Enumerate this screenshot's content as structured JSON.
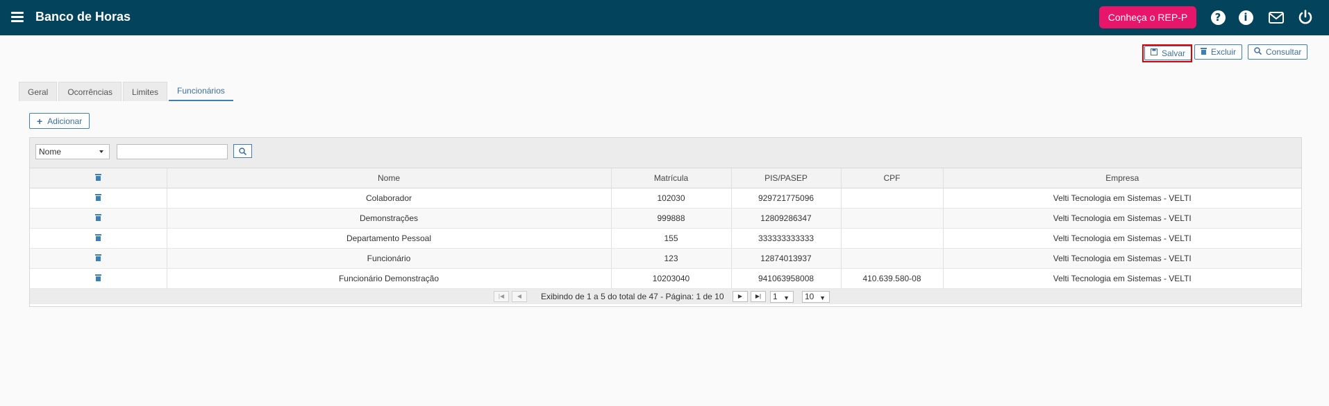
{
  "header": {
    "title": "Banco de Horas",
    "rep_button": "Conheça o REP-P",
    "icons": [
      "help-icon",
      "info-icon",
      "mail-icon",
      "power-icon"
    ]
  },
  "actions": {
    "save": "Salvar",
    "delete": "Excluir",
    "consult": "Consultar"
  },
  "tabs": [
    {
      "label": "Geral"
    },
    {
      "label": "Ocorrências"
    },
    {
      "label": "Limites"
    },
    {
      "label": "Funcionários",
      "active": true
    }
  ],
  "add_button": "Adicionar",
  "filter": {
    "field": "Nome",
    "value": ""
  },
  "table": {
    "columns": [
      "",
      "Nome",
      "Matrícula",
      "PIS/PASEP",
      "CPF",
      "Empresa"
    ],
    "rows": [
      {
        "nome": "Colaborador",
        "matricula": "102030",
        "pis": "929721775096",
        "cpf": "",
        "empresa": "Velti Tecnologia em Sistemas - VELTI"
      },
      {
        "nome": "Demonstrações",
        "matricula": "999888",
        "pis": "12809286347",
        "cpf": "",
        "empresa": "Velti Tecnologia em Sistemas - VELTI"
      },
      {
        "nome": "Departamento Pessoal",
        "matricula": "155",
        "pis": "333333333333",
        "cpf": "",
        "empresa": "Velti Tecnologia em Sistemas - VELTI"
      },
      {
        "nome": "Funcionário",
        "matricula": "123",
        "pis": "12874013937",
        "cpf": "",
        "empresa": "Velti Tecnologia em Sistemas - VELTI"
      },
      {
        "nome": "Funcionário Demonstração",
        "matricula": "10203040",
        "pis": "941063958008",
        "cpf": "410.639.580-08",
        "empresa": "Velti Tecnologia em Sistemas - VELTI"
      }
    ]
  },
  "pager": {
    "info": "Exibindo de 1 a 5 do total de 47 - Página: 1 de 10",
    "page": "1",
    "page_size": "10"
  },
  "colors": {
    "header_bg": "#03435c",
    "rep_button": "#e8166a",
    "accent": "#3b7fb5",
    "highlight": "#e00000"
  }
}
